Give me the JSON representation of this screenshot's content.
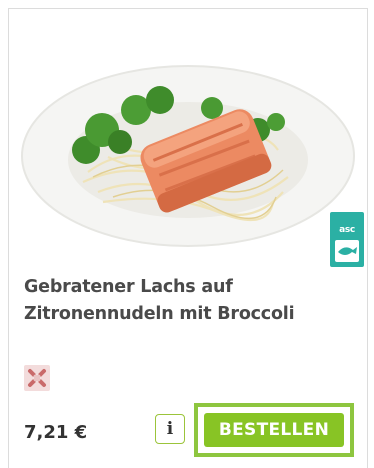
{
  "product": {
    "title_line1": "Gebratener Lachs auf",
    "title_line2": "Zitronennudeln mit Broccoli",
    "price": "7,21 €",
    "image_subject": "salmon-pasta-broccoli-dish",
    "badge": {
      "icon": "asc-certification-badge",
      "text": "asc"
    },
    "diet_icon": "no-restriction-crossed-icon"
  },
  "actions": {
    "info_label": "i",
    "order_label": "BESTELLEN"
  },
  "colors": {
    "accent_green": "#88c425",
    "highlight_outline": "#8ec63f",
    "asc_teal": "#2bb0a4",
    "title_text": "#4a4a4a"
  }
}
